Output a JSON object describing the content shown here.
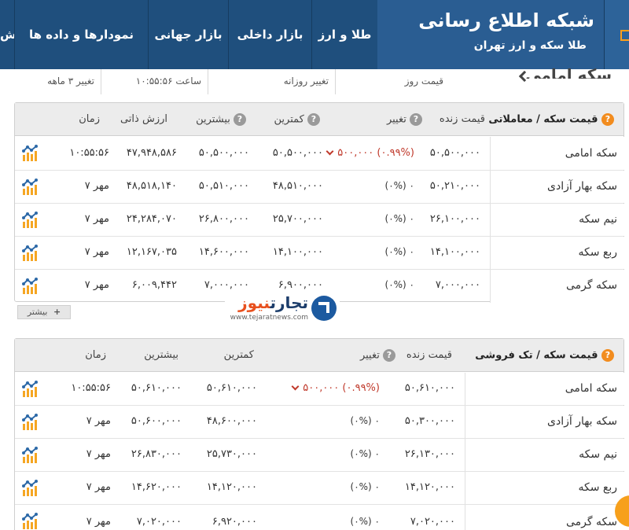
{
  "header": {
    "brand_title": "شبکه اطلاع رسانی",
    "brand_subtitle": "طلا  سکه  و ارز تهران",
    "nav": [
      "طلا و ارز",
      "بازار داخلی",
      "بازار جهانی",
      "نمودارها و داده ها",
      "ش"
    ]
  },
  "strip": {
    "page_title": "سکه امامی",
    "price_day_label": "قیمت روز",
    "daily_change_label": "تغییر روزانه",
    "time_label": "ساعت ۱۰:۵۵:۵۶",
    "three_month_label": "تغییر ۳ ماهه"
  },
  "table1": {
    "title": "قیمت سکه / معاملاتی",
    "help": "?",
    "headers": {
      "live": "قیمت زنده",
      "change": "تغییر",
      "low": "کمترین",
      "high": "بیشترین",
      "intrinsic": "ارزش ذاتی",
      "time": "زمان"
    },
    "rows": [
      {
        "name": "سکه امامی",
        "live": "۵۰,۵۰۰,۰۰۰",
        "change": "۵۰۰,۰۰۰ (۰.۹۹%)",
        "low": "۵۰,۵۰۰,۰۰۰",
        "high": "۵۰,۵۰۰,۰۰۰",
        "intrinsic": "۴۷,۹۴۸,۵۸۶",
        "time": "۱۰:۵۵:۵۶"
      },
      {
        "name": "سکه بهار آزادی",
        "live": "۵۰,۲۱۰,۰۰۰",
        "change": "(۰%) ۰",
        "low": "۴۸,۵۱۰,۰۰۰",
        "high": "۵۰,۵۱۰,۰۰۰",
        "intrinsic": "۴۸,۵۱۸,۱۴۰",
        "time": "۷ مهر"
      },
      {
        "name": "نیم سکه",
        "live": "۲۶,۱۰۰,۰۰۰",
        "change": "(۰%) ۰",
        "low": "۲۵,۷۰۰,۰۰۰",
        "high": "۲۶,۸۰۰,۰۰۰",
        "intrinsic": "۲۴,۲۸۴,۰۷۰",
        "time": "۷ مهر"
      },
      {
        "name": "ربع سکه",
        "live": "۱۴,۱۰۰,۰۰۰",
        "change": "(۰%) ۰",
        "low": "۱۴,۱۰۰,۰۰۰",
        "high": "۱۴,۶۰۰,۰۰۰",
        "intrinsic": "۱۲,۱۶۷,۰۳۵",
        "time": "۷ مهر"
      },
      {
        "name": "سکه گرمی",
        "live": "۷,۰۰۰,۰۰۰",
        "change": "(۰%) ۰",
        "low": "۶,۹۰۰,۰۰۰",
        "high": "۷,۰۰۰,۰۰۰",
        "intrinsic": "۶,۰۰۹,۴۴۲",
        "time": "۷ مهر"
      }
    ],
    "more_label": "بیشتر"
  },
  "watermark": {
    "brand_a": "تجارت",
    "brand_b": "نیوز",
    "url": "www.tejaratnews.com"
  },
  "table2": {
    "title": "قیمت سکه / تک فروشی",
    "help": "?",
    "headers": {
      "live": "قیمت زنده",
      "change": "تغییر",
      "low": "کمترین",
      "high": "بیشترین",
      "time": "زمان"
    },
    "rows": [
      {
        "name": "سکه امامی",
        "live": "۵۰,۶۱۰,۰۰۰",
        "change": "۵۰۰,۰۰۰ (۰.۹۹%)",
        "low": "۵۰,۶۱۰,۰۰۰",
        "high": "۵۰,۶۱۰,۰۰۰",
        "time": "۱۰:۵۵:۵۶"
      },
      {
        "name": "سکه بهار آزادی",
        "live": "۵۰,۳۰۰,۰۰۰",
        "change": "(۰%) ۰",
        "low": "۴۸,۶۰۰,۰۰۰",
        "high": "۵۰,۶۰۰,۰۰۰",
        "time": "۷ مهر"
      },
      {
        "name": "نیم سکه",
        "live": "۲۶,۱۳۰,۰۰۰",
        "change": "(۰%) ۰",
        "low": "۲۵,۷۳۰,۰۰۰",
        "high": "۲۶,۸۳۰,۰۰۰",
        "time": "۷ مهر"
      },
      {
        "name": "ربع سکه",
        "live": "۱۴,۱۲۰,۰۰۰",
        "change": "(۰%) ۰",
        "low": "۱۴,۱۲۰,۰۰۰",
        "high": "۱۴,۶۲۰,۰۰۰",
        "time": "۷ مهر"
      },
      {
        "name": "سکه گرمی",
        "live": "۷,۰۲۰,۰۰۰",
        "change": "(۰%) ۰",
        "low": "۶,۹۲۰,۰۰۰",
        "high": "۷,۰۲۰,۰۰۰",
        "time": "۷ مهر"
      }
    ]
  },
  "colors": {
    "nav_bg": "#1f4f7d",
    "brand_bg": "#2a5d92",
    "accent_orange": "#f28c1e",
    "negative_red": "#c0392b",
    "chart_icon_blue": "#2e6aa8",
    "chart_icon_orange": "#f5a623"
  },
  "icons": {
    "row_chart": "bar-chart-icon",
    "help": "question-icon",
    "more": "plus-icon"
  }
}
